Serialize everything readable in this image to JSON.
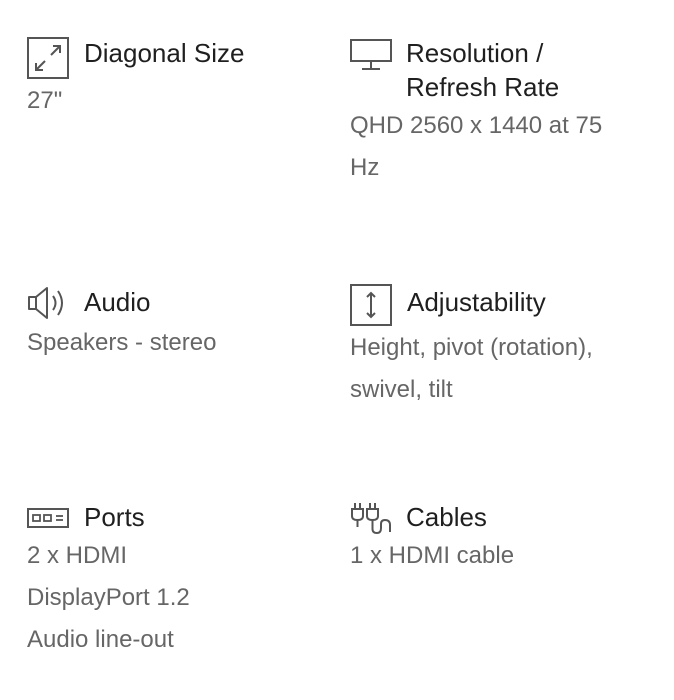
{
  "specs": [
    {
      "icon": "diagonal-arrows-icon",
      "title": "Diagonal Size",
      "value": "27\""
    },
    {
      "icon": "monitor-icon",
      "title": "Resolution /\nRefresh Rate",
      "value": "QHD 2560 x 1440 at 75\nHz"
    },
    {
      "icon": "speaker-icon",
      "title": "Audio",
      "value": "Speakers - stereo"
    },
    {
      "icon": "vertical-adjust-icon",
      "title": "Adjustability",
      "value": "Height, pivot (rotation),\nswivel, tilt"
    },
    {
      "icon": "ports-icon",
      "title": "Ports",
      "value": "2 x HDMI\nDisplayPort 1.2\nAudio line-out"
    },
    {
      "icon": "cable-plug-icon",
      "title": "Cables",
      "value": "1 x HDMI cable"
    }
  ],
  "colors": {
    "title": "#1f1f1f",
    "value": "#666666",
    "icon": "#555555",
    "background": "#ffffff"
  }
}
